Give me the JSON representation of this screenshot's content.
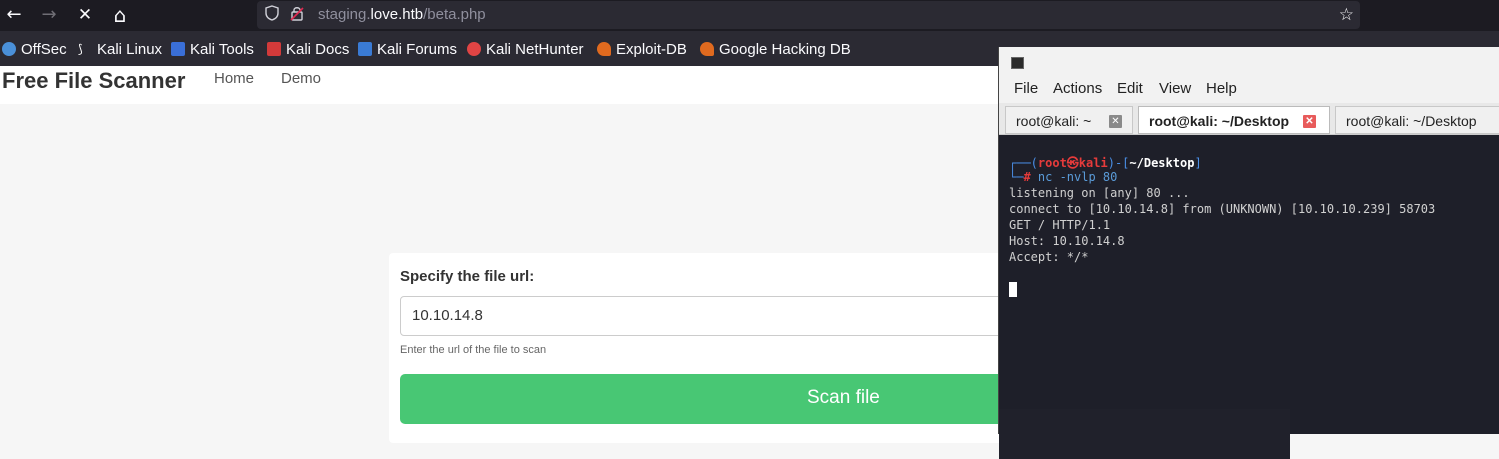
{
  "browser": {
    "nav": {
      "back": "←",
      "forward": "→",
      "stop": "✕",
      "home": "⌂"
    },
    "url": {
      "prefix": "staging.",
      "host": "love.htb",
      "path": "/beta.php"
    },
    "bookmarks": [
      {
        "label": "OffSec",
        "color": "#4a90d9"
      },
      {
        "label": "Kali Linux",
        "color": "#2b2a33"
      },
      {
        "label": "Kali Tools",
        "color": "#3a6fd8"
      },
      {
        "label": "Kali Docs",
        "color": "#d23a3a"
      },
      {
        "label": "Kali Forums",
        "color": "#3a7bd5"
      },
      {
        "label": "Kali NetHunter",
        "color": "#e04444"
      },
      {
        "label": "Exploit-DB",
        "color": "#e06a1f"
      },
      {
        "label": "Google Hacking DB",
        "color": "#e06a1f"
      }
    ]
  },
  "site": {
    "brand": "Free File Scanner",
    "nav": [
      "Home",
      "Demo"
    ],
    "form": {
      "label": "Specify the file url:",
      "value": "10.10.14.8",
      "help": "Enter the url of the file to scan",
      "button": "Scan file",
      "button_color": "#48c774"
    }
  },
  "terminal": {
    "menu": [
      "File",
      "Actions",
      "Edit",
      "View",
      "Help"
    ],
    "tabs": [
      "root@kali: ~",
      "root@kali: ~/Desktop",
      "root@kali: ~/Desktop"
    ],
    "prompt": {
      "open": "┌──(",
      "user": "root㉿kali",
      "mid": ")-[",
      "dir": "~/Desktop",
      "close": "]",
      "hash_prefix": "└─",
      "hash": "#",
      "command": " nc -nvlp 80"
    },
    "output": [
      "listening on [any] 80 ...",
      "connect to [10.10.14.8] from (UNKNOWN) [10.10.10.239] 58703",
      "GET / HTTP/1.1",
      "Host: 10.10.14.8",
      "Accept: */*"
    ]
  }
}
